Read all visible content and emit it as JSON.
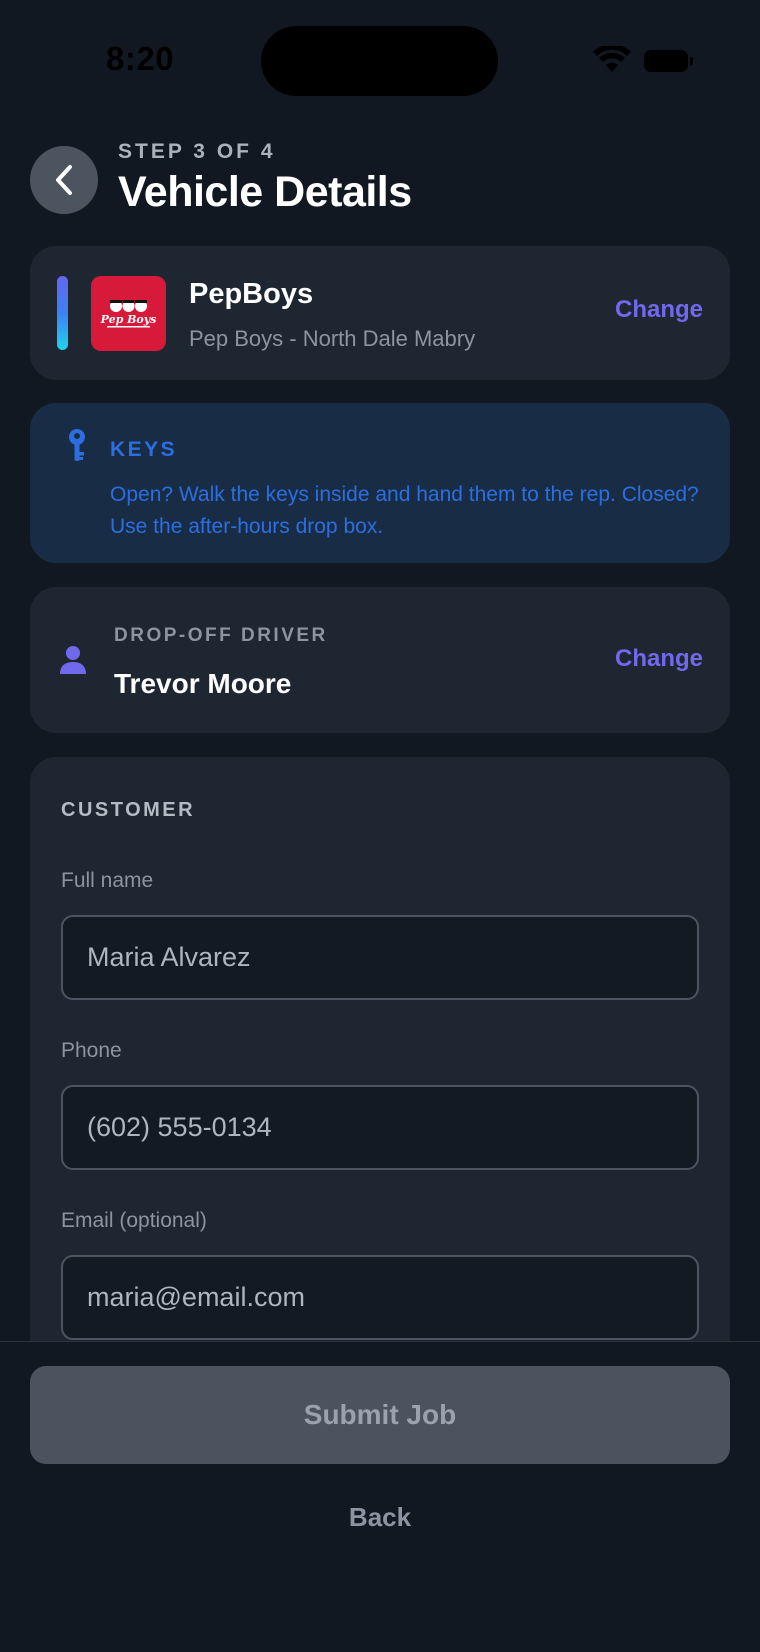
{
  "status_bar": {
    "time": "8:20"
  },
  "header": {
    "step": "STEP 3 OF 4",
    "title": "Vehicle Details"
  },
  "shop": {
    "name": "PepBoys",
    "location": "Pep Boys - North Dale Mabry",
    "logo_text": "Pep Boys",
    "change_label": "Change",
    "brand_color": "#d7193a"
  },
  "keys": {
    "title": "KEYS",
    "instructions": "Open? Walk the keys inside and hand them to the rep. Closed? Use the after-hours drop box."
  },
  "driver": {
    "label": "DROP-OFF DRIVER",
    "name": "Trevor Moore",
    "change_label": "Change"
  },
  "customer": {
    "section_title": "CUSTOMER",
    "full_name": {
      "label": "Full name",
      "value": "Maria Alvarez"
    },
    "phone": {
      "label": "Phone",
      "value": "(602) 555-0134"
    },
    "email": {
      "label": "Email (optional)",
      "value": "maria@email.com"
    }
  },
  "actions": {
    "submit_label": "Submit Job",
    "back_label": "Back"
  },
  "colors": {
    "accent": "#7169ec",
    "info": "#2c6ee0",
    "background": "#121821",
    "card": "#1e2731"
  }
}
